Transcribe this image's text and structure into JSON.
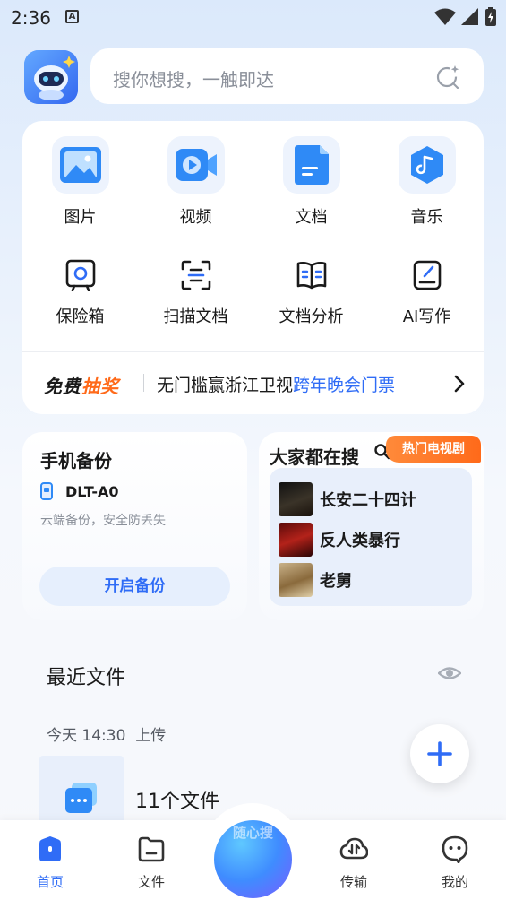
{
  "status_bar": {
    "time": "2:36",
    "notif_letter": "A"
  },
  "search": {
    "placeholder": "搜你想搜，一触即达"
  },
  "tools": [
    {
      "label": "图片",
      "icon": "image-icon"
    },
    {
      "label": "视频",
      "icon": "video-icon"
    },
    {
      "label": "文档",
      "icon": "document-icon"
    },
    {
      "label": "音乐",
      "icon": "music-icon"
    },
    {
      "label": "保险箱",
      "icon": "safe-icon"
    },
    {
      "label": "扫描文档",
      "icon": "scan-icon"
    },
    {
      "label": "文档分析",
      "icon": "book-icon"
    },
    {
      "label": "AI写作",
      "icon": "write-icon"
    }
  ],
  "promo": {
    "tag_part1": "免费",
    "tag_part2": "抽奖",
    "text": "无门槛赢浙江卫视",
    "link": "跨年晚会门票"
  },
  "backup": {
    "title": "手机备份",
    "device": "DLT-A0",
    "subtitle": "云端备份，安全防丢失",
    "button": "开启备份"
  },
  "hot": {
    "title": "大家都在搜",
    "tag": "热门电视剧",
    "items": [
      {
        "name": "长安二十四计"
      },
      {
        "name": "反人类暴行"
      },
      {
        "name": "老舅"
      }
    ]
  },
  "recent": {
    "title": "最近文件",
    "time": "今天 14:30",
    "action": "上传",
    "count": "11个文件"
  },
  "nav": {
    "home": "首页",
    "files": "文件",
    "center": "随心搜",
    "transfer": "传输",
    "mine": "我的"
  },
  "colors": {
    "accent": "#2f6cf6",
    "promo_orange": "#ff6a1a"
  }
}
